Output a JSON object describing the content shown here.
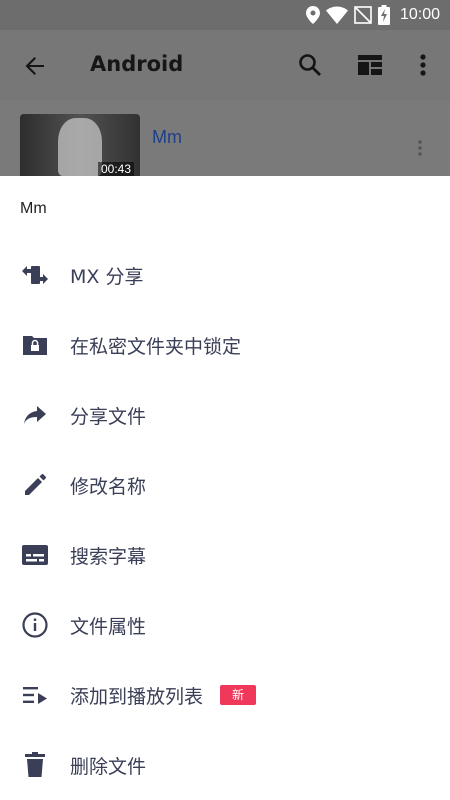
{
  "status_bar": {
    "time": "10:00",
    "icons": [
      "location-icon",
      "wifi-icon",
      "no-sim-icon",
      "battery-charging-icon"
    ]
  },
  "app_bar": {
    "title": "Android",
    "icons": [
      "back-arrow-icon",
      "search-icon",
      "view-layout-icon",
      "more-vert-icon"
    ]
  },
  "video": {
    "title": "Mm",
    "duration": "00:43"
  },
  "sheet": {
    "title": "Mm",
    "items": [
      {
        "label": "MX 分享",
        "icon": "mx-share-icon"
      },
      {
        "label": "在私密文件夹中锁定",
        "icon": "lock-folder-icon"
      },
      {
        "label": "分享文件",
        "icon": "share-arrow-icon"
      },
      {
        "label": "修改名称",
        "icon": "edit-pencil-icon"
      },
      {
        "label": "搜索字幕",
        "icon": "subtitles-icon"
      },
      {
        "label": "文件属性",
        "icon": "info-icon"
      },
      {
        "label": "添加到播放列表",
        "icon": "playlist-add-icon",
        "badge": "新"
      },
      {
        "label": "删除文件",
        "icon": "trash-icon"
      }
    ]
  },
  "colors": {
    "icon": "#3a3f57",
    "badge": "#f0395a",
    "video_title": "#1d3f8a",
    "overlay": "#777777"
  }
}
